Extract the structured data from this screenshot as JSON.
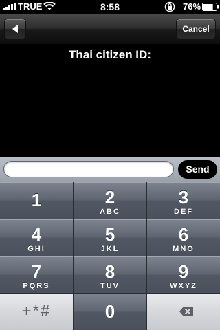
{
  "status_bar": {
    "carrier": "TRUE",
    "time": "8:58",
    "battery_percent": "76%",
    "icons": [
      "signal-bars-icon",
      "wifi-icon",
      "rotation-lock-icon",
      "battery-icon"
    ],
    "battery_level": 0.76
  },
  "nav": {
    "back_icon": "left-arrow-icon",
    "cancel_label": "Cancel"
  },
  "content": {
    "prompt": "Thai citizen ID:"
  },
  "input": {
    "value": "",
    "placeholder": ""
  },
  "send_label": "Send",
  "keypad": {
    "keys": [
      {
        "digit": "1",
        "letters": ""
      },
      {
        "digit": "2",
        "letters": "ABC"
      },
      {
        "digit": "3",
        "letters": "DEF"
      },
      {
        "digit": "4",
        "letters": "GHI"
      },
      {
        "digit": "5",
        "letters": "JKL"
      },
      {
        "digit": "6",
        "letters": "MNO"
      },
      {
        "digit": "7",
        "letters": "PQRS"
      },
      {
        "digit": "8",
        "letters": "TUV"
      },
      {
        "digit": "9",
        "letters": "WXYZ"
      },
      {
        "symbols": "+*#"
      },
      {
        "digit": "0",
        "letters": ""
      },
      {
        "icon": "backspace-icon"
      }
    ]
  },
  "colors": {
    "key_dark": "#5f6671",
    "key_light": "#d6d8dc",
    "nav_bar": "#2d2d2d",
    "input_bar": "#a9afb8"
  }
}
